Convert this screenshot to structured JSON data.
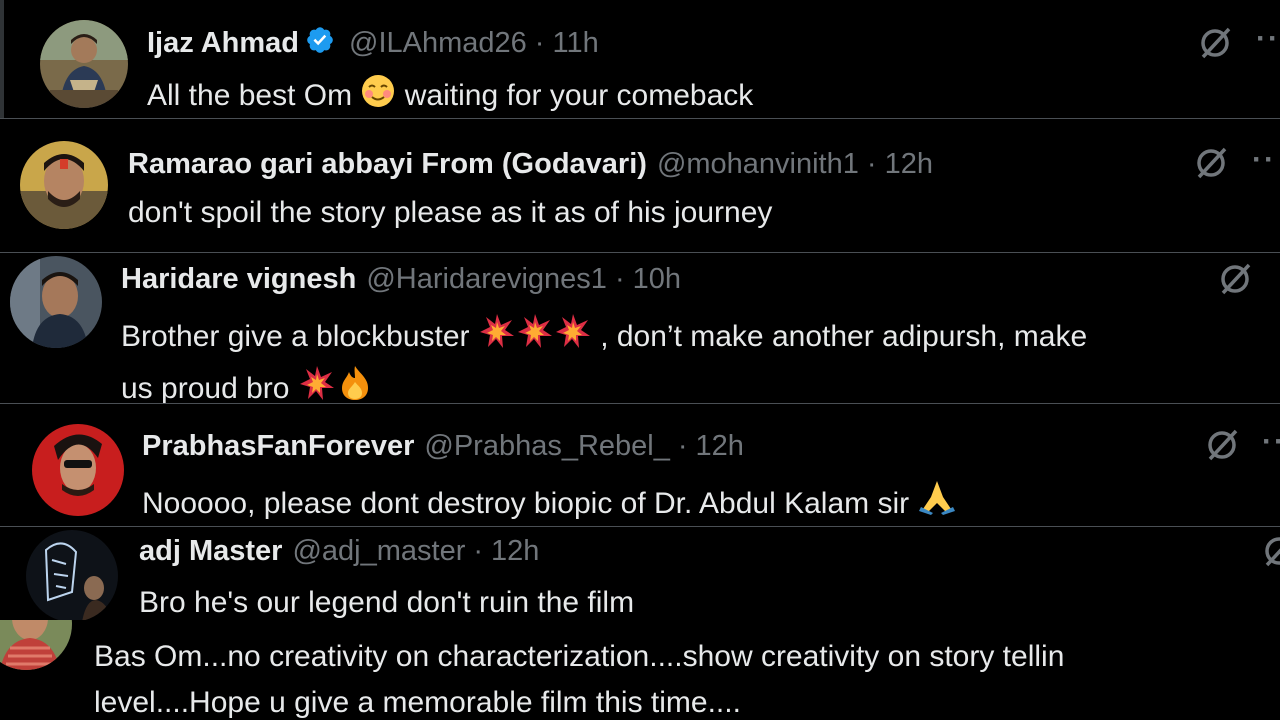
{
  "replies": [
    {
      "name": "Ijaz Ahmad",
      "verified": true,
      "handle": "@ILAhmad26",
      "separator": "·",
      "time": "11h",
      "text_before": "All the best Om",
      "emoji_1": "smiling-blushing-emoji",
      "text_after": "waiting for your comeback"
    },
    {
      "name": "Ramarao gari abbayi From (Godavari)",
      "handle": "@mohanvinith1",
      "separator": "·",
      "time": "12h",
      "text": "don't spoil the story please as it as of his journey"
    },
    {
      "name": "Haridare vignesh",
      "handle": "@Haridarevignes1",
      "separator": "·",
      "time": "10h",
      "text_line1_before": "Brother give a blockbuster",
      "text_line1_after": ", don’t make another adipursh, make",
      "text_line2": "us proud bro",
      "emojis": [
        "collision-emoji",
        "collision-emoji",
        "collision-emoji",
        "collision-emoji",
        "fire-emoji"
      ]
    },
    {
      "name": "PrabhasFanForever",
      "handle": "@Prabhas_Rebel_",
      "separator": "·",
      "time": "12h",
      "text": "Nooooo, please dont destroy biopic of Dr. Abdul Kalam sir",
      "emoji": "folded-hands-emoji"
    },
    {
      "name": "adj Master",
      "handle": "@adj_master",
      "separator": "·",
      "time": "12h",
      "text": "Bro he's our legend don't ruin the film"
    },
    {
      "text_line1": "Bas Om...no creativity on characterization....show creativity on story tellin",
      "text_line2": "level....Hope u give a memorable film this time...."
    }
  ],
  "icons": {
    "grok": "grok-icon",
    "more": "more-options-icon"
  },
  "more_glyph": "··",
  "colors": {
    "background": "#000000",
    "text": "#e7e9ea",
    "secondary": "#71767b",
    "verified": "#1d9bf0",
    "divider": "#4a4f54"
  }
}
